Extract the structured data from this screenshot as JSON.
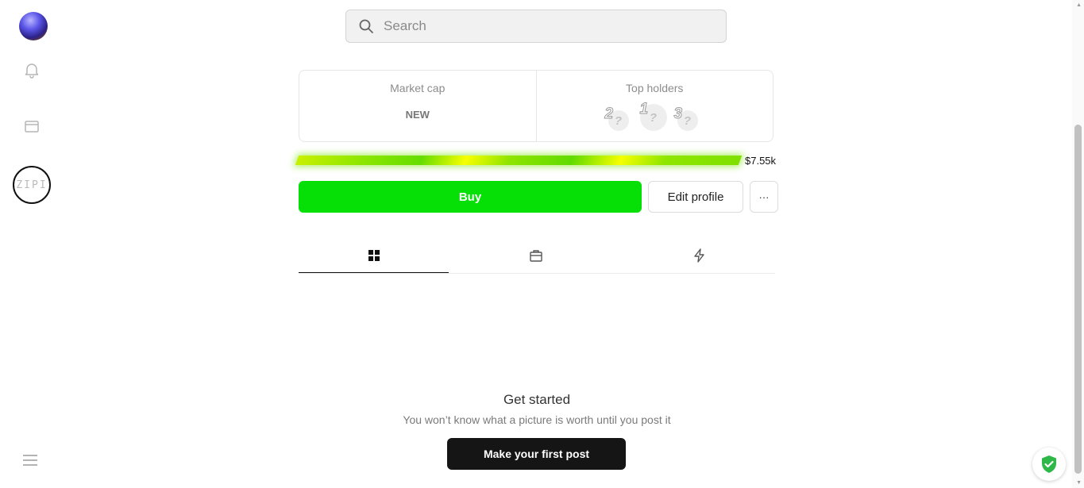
{
  "search": {
    "placeholder": "Search"
  },
  "sidebar": {
    "zip_label": "ZIPI"
  },
  "stats": {
    "market_cap": {
      "label": "Market cap",
      "value": "NEW"
    },
    "top_holders": {
      "label": "Top holders",
      "holders": [
        {
          "rank": "2",
          "symbol": "?"
        },
        {
          "rank": "1",
          "symbol": "?"
        },
        {
          "rank": "3",
          "symbol": "?"
        }
      ]
    }
  },
  "progress": {
    "label": "$7.55k"
  },
  "actions": {
    "buy": "Buy",
    "edit_profile": "Edit profile",
    "more": "···"
  },
  "tabs": [
    {
      "icon": "grid-icon",
      "active": true
    },
    {
      "icon": "bag-icon",
      "active": false
    },
    {
      "icon": "lightning-icon",
      "active": false
    }
  ],
  "empty_state": {
    "title": "Get started",
    "subtitle": "You won’t know what a picture is worth until you post it",
    "button": "Make your first post"
  },
  "colors": {
    "buy": "#06e006",
    "primary_dark": "#151515",
    "shield": "#2eb84a"
  }
}
